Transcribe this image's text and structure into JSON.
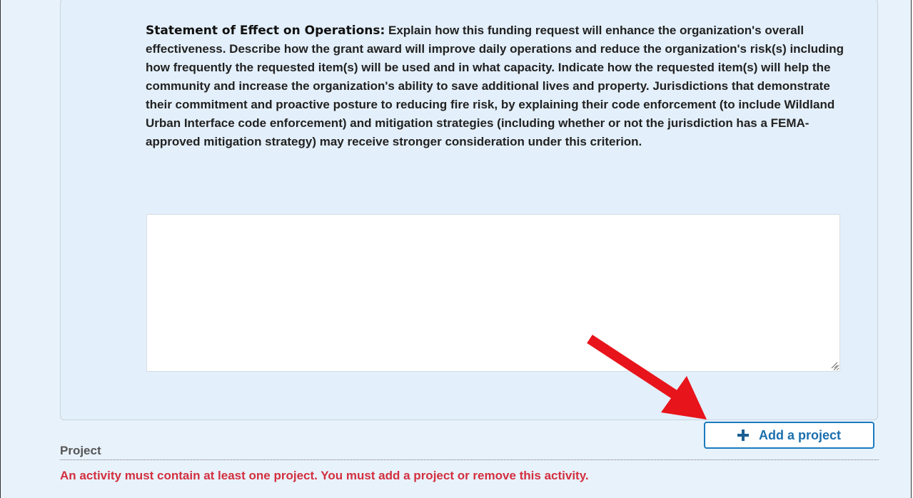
{
  "statement": {
    "heading": "Statement of Effect on Operations:",
    "body": " Explain how this funding request will enhance the organization's overall effectiveness. Describe how the grant award will improve daily operations and reduce the organization's risk(s) including how frequently the requested item(s) will be used and in what capacity. Indicate how the requested item(s) will help the community and increase the organization's ability to save additional lives and property. Jurisdictions that demonstrate their commitment and proactive posture to reducing fire risk, by explaining their code enforcement (to include Wildland Urban Interface code enforcement) and mitigation strategies (including whether or not the jurisdiction has a FEMA-approved mitigation strategy) may receive stronger consideration under this criterion."
  },
  "response_textarea": {
    "value": ""
  },
  "add_project": {
    "label": "Add a project",
    "icon": "plus-icon"
  },
  "project_section": {
    "label": "Project"
  },
  "error_message": "An activity must contain at least one project. You must add a project or remove this activity.",
  "colors": {
    "accent": "#1a7bbd",
    "error": "#d32f3f",
    "annotation_arrow": "#e8141b",
    "panel_bg": "#e3effa"
  }
}
